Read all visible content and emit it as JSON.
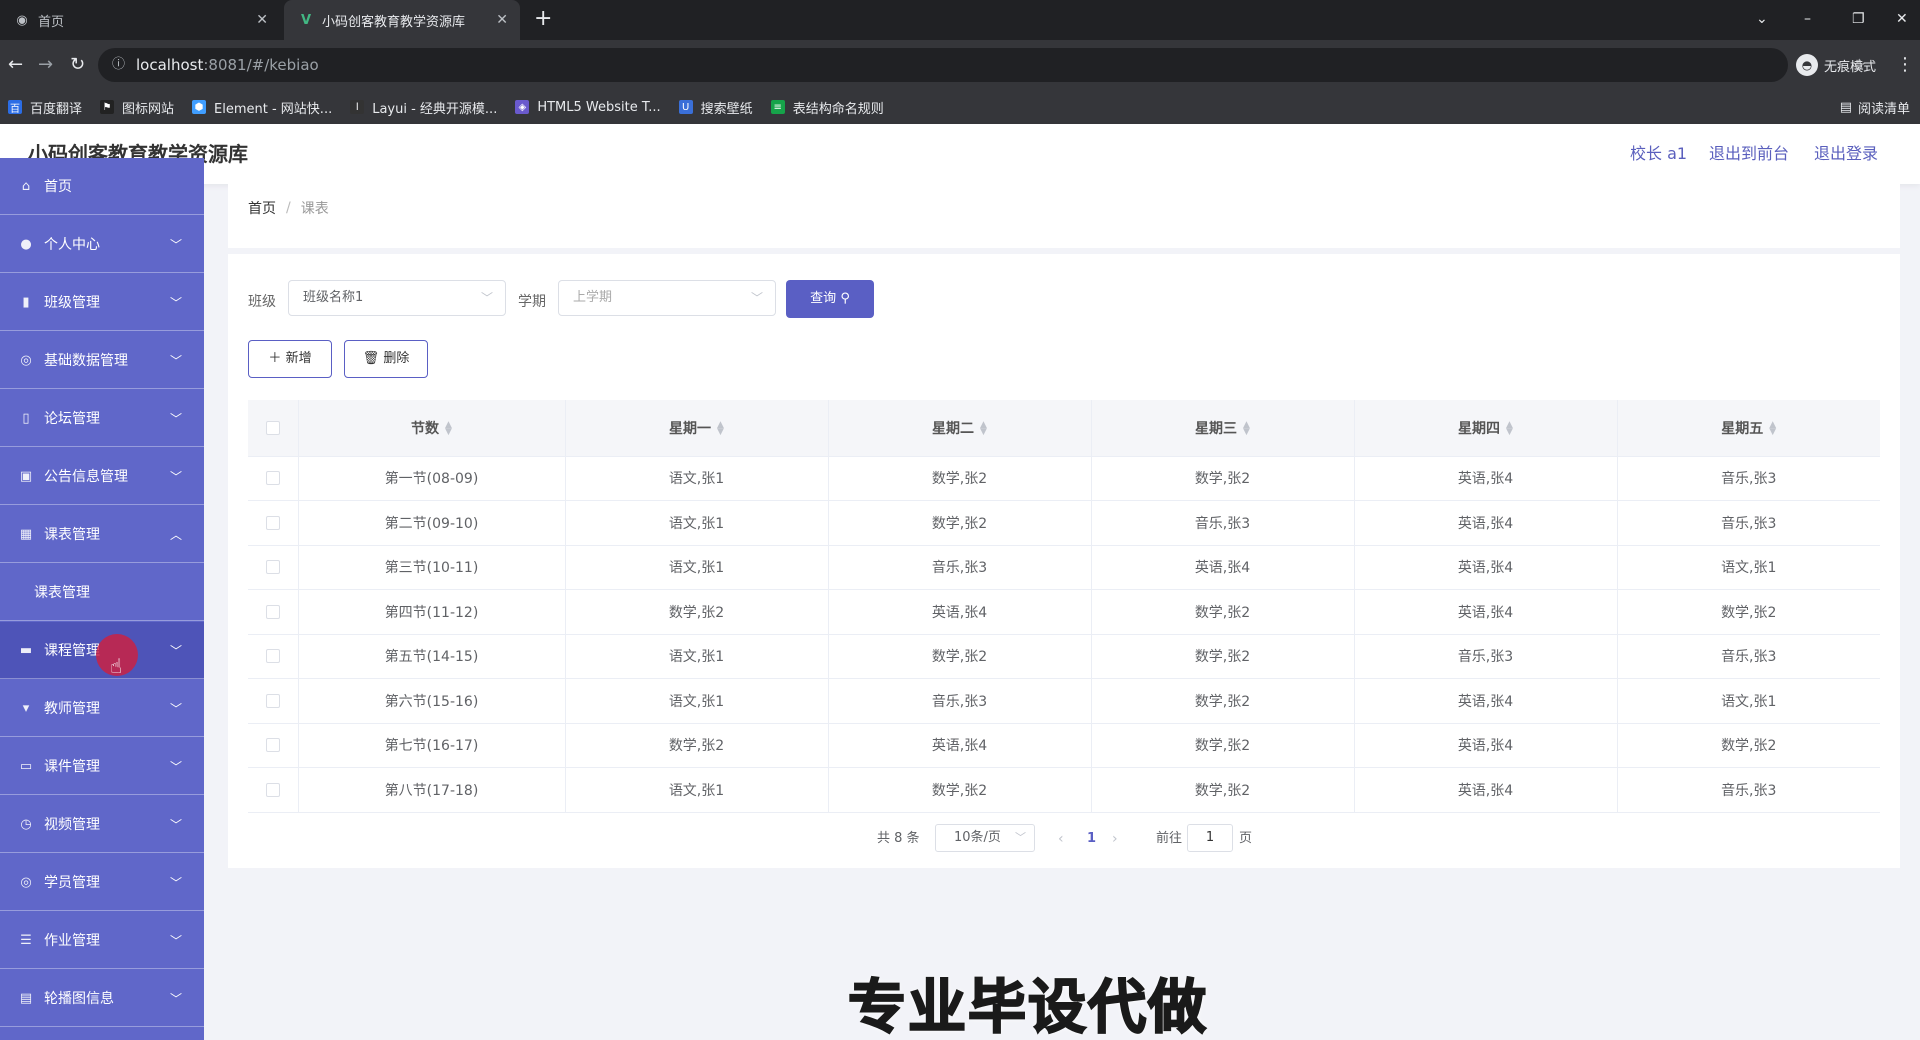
{
  "browser": {
    "tabs": [
      {
        "title": "首页"
      },
      {
        "title": "小码创客教育教学资源库"
      }
    ],
    "url_host": "localhost",
    "url_path": ":8081/#/kebiao",
    "profile_label": "无痕模式",
    "reading_list": "阅读清单",
    "bookmarks": [
      "百度翻译",
      "图标网站",
      "Element - 网站快...",
      "Layui - 经典开源模...",
      "HTML5 Website T...",
      "搜索壁纸",
      "表结构命名规则"
    ]
  },
  "header": {
    "title": "小码创客教育教学资源库",
    "user": "校长 a1",
    "front_link": "退出到前台",
    "logout_link": "退出登录"
  },
  "sidebar": {
    "items": [
      {
        "label": "首页",
        "icon": "home-icon"
      },
      {
        "label": "个人中心",
        "icon": "user-icon"
      },
      {
        "label": "班级管理",
        "icon": "chart-icon"
      },
      {
        "label": "基础数据管理",
        "icon": "circle-icon"
      },
      {
        "label": "论坛管理",
        "icon": "forum-icon"
      },
      {
        "label": "公告信息管理",
        "icon": "notice-icon"
      },
      {
        "label": "课表管理",
        "icon": "schedule-icon"
      },
      {
        "label": "课程管理",
        "icon": "course-icon"
      },
      {
        "label": "教师管理",
        "icon": "teacher-icon"
      },
      {
        "label": "课件管理",
        "icon": "courseware-icon"
      },
      {
        "label": "视频管理",
        "icon": "video-icon"
      },
      {
        "label": "学员管理",
        "icon": "student-icon"
      },
      {
        "label": "作业管理",
        "icon": "homework-icon"
      },
      {
        "label": "轮播图信息",
        "icon": "carousel-icon"
      }
    ],
    "submenu": {
      "label": "课表管理"
    }
  },
  "breadcrumb": {
    "home": "首页",
    "current": "课表"
  },
  "filters": {
    "class_label": "班级",
    "class_value": "班级名称1",
    "term_label": "学期",
    "term_value": "上学期",
    "query_button": "查询"
  },
  "actions": {
    "add": "新增",
    "delete": "删除"
  },
  "table": {
    "columns": [
      "节数",
      "星期一",
      "星期二",
      "星期三",
      "星期四",
      "星期五"
    ],
    "rows": [
      [
        "第一节(08-09)",
        "语文,张1",
        "数学,张2",
        "数学,张2",
        "英语,张4",
        "音乐,张3"
      ],
      [
        "第二节(09-10)",
        "语文,张1",
        "数学,张2",
        "音乐,张3",
        "英语,张4",
        "音乐,张3"
      ],
      [
        "第三节(10-11)",
        "语文,张1",
        "音乐,张3",
        "英语,张4",
        "英语,张4",
        "语文,张1"
      ],
      [
        "第四节(11-12)",
        "数学,张2",
        "英语,张4",
        "数学,张2",
        "英语,张4",
        "数学,张2"
      ],
      [
        "第五节(14-15)",
        "语文,张1",
        "数学,张2",
        "数学,张2",
        "音乐,张3",
        "音乐,张3"
      ],
      [
        "第六节(15-16)",
        "语文,张1",
        "音乐,张3",
        "数学,张2",
        "英语,张4",
        "语文,张1"
      ],
      [
        "第七节(16-17)",
        "数学,张2",
        "英语,张4",
        "数学,张2",
        "英语,张4",
        "数学,张2"
      ],
      [
        "第八节(17-18)",
        "语文,张1",
        "数学,张2",
        "数学,张2",
        "英语,张4",
        "音乐,张3"
      ]
    ]
  },
  "pagination": {
    "total": "共 8 条",
    "page_size": "10条/页",
    "current_page": "1",
    "goto_label": "前往",
    "goto_value": "1",
    "page_unit": "页"
  },
  "watermark": "专业毕设代做",
  "colors": {
    "accent": "#5a5fc4",
    "sidebar": "#6067c9"
  }
}
